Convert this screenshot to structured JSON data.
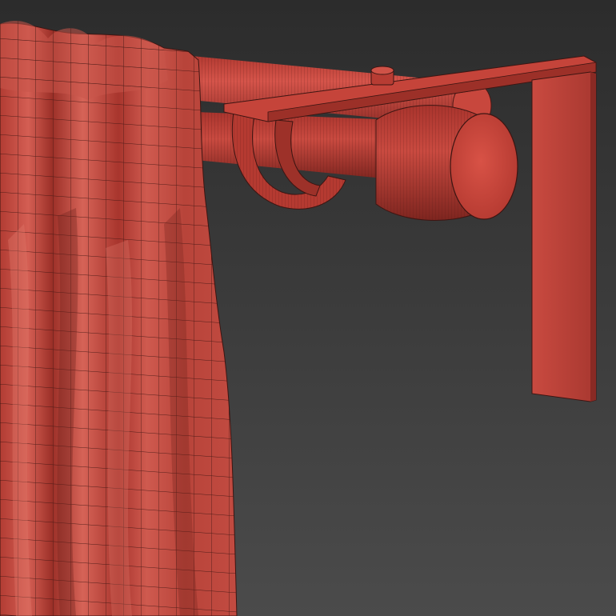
{
  "scene": {
    "subject": "curtain-on-double-rod-render",
    "render_style": "wireframe-over-shaded",
    "colors": {
      "background_top": "#2e2e2e",
      "background_bottom": "#4a4a4a",
      "model_base": "#c8453c",
      "model_light": "#e06a5e",
      "model_shadow": "#8a2a24",
      "wire": "#3d1512"
    }
  }
}
